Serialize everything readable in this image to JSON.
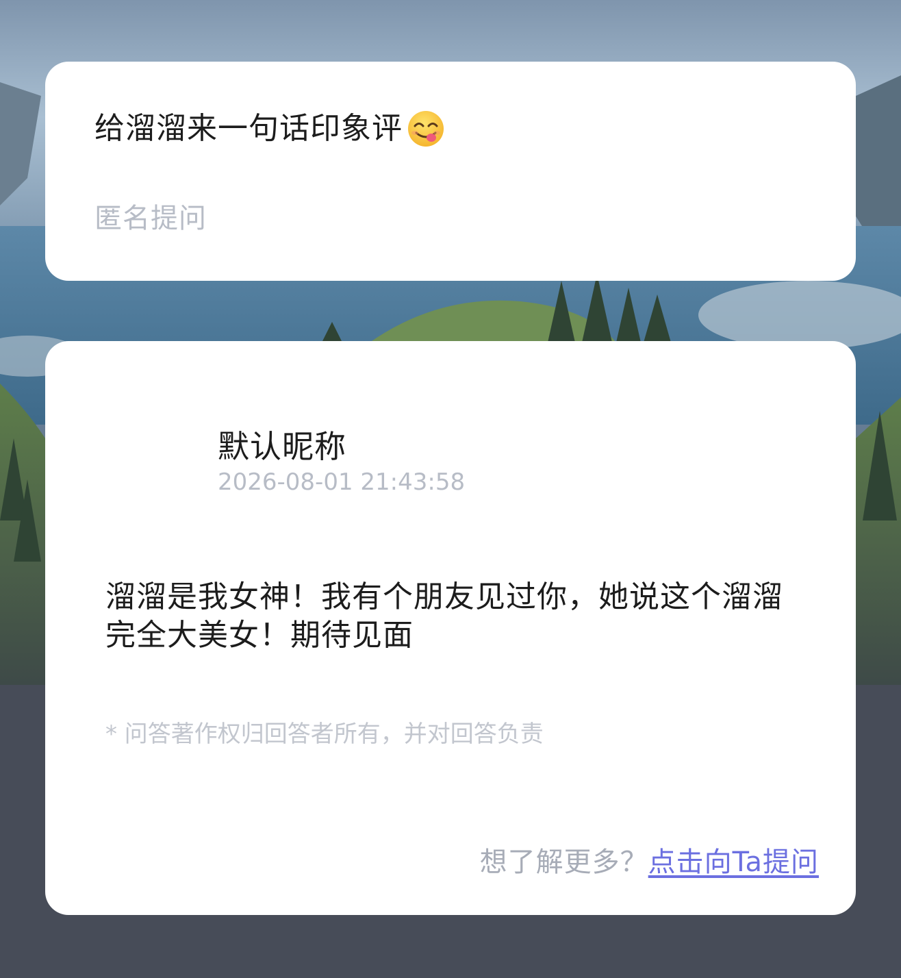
{
  "question_card": {
    "question_text": "给溜溜来一句话印象评",
    "emoji_icon": "savoring-food-face-icon",
    "anonymous_label": "匿名提问"
  },
  "answer_card": {
    "nickname": "默认昵称",
    "timestamp": "2026-08-01 21:43:58",
    "answer_text": "溜溜是我女神！我有个朋友见过你，她说这个溜溜完全大美女！期待见面",
    "copyright_note": "* 问答著作权归回答者所有，并对回答负责",
    "footer_prompt": "想了解更多？",
    "footer_link": "点击向Ta提问"
  },
  "colors": {
    "link": "#6b6fe0",
    "muted_text": "#b7bcc6",
    "bottom_background": "#4a5060"
  }
}
